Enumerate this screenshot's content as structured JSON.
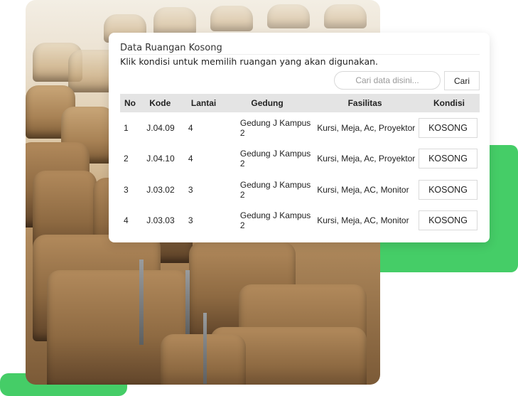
{
  "card": {
    "title": "Data Ruangan Kosong",
    "subtitle": "Klik kondisi untuk memilih ruangan yang akan digunakan."
  },
  "search": {
    "placeholder": "Cari data disini...",
    "button_label": "Cari"
  },
  "table": {
    "headers": {
      "no": "No",
      "kode": "Kode",
      "lantai": "Lantai",
      "gedung": "Gedung",
      "fasilitas": "Fasilitas",
      "kondisi": "Kondisi"
    },
    "rows": [
      {
        "no": "1",
        "kode": "J.04.09",
        "lantai": "4",
        "gedung": "Gedung J Kampus 2",
        "fasilitas": "Kursi, Meja, Ac, Proyektor",
        "kondisi": "KOSONG"
      },
      {
        "no": "2",
        "kode": "J.04.10",
        "lantai": "4",
        "gedung": "Gedung J Kampus 2",
        "fasilitas": "Kursi, Meja, Ac, Proyektor",
        "kondisi": "KOSONG"
      },
      {
        "no": "3",
        "kode": "J.03.02",
        "lantai": "3",
        "gedung": "Gedung J Kampus 2",
        "fasilitas": "Kursi, Meja, AC, Monitor",
        "kondisi": "KOSONG"
      },
      {
        "no": "4",
        "kode": "J.03.03",
        "lantai": "3",
        "gedung": "Gedung J Kampus 2",
        "fasilitas": "Kursi, Meja, AC, Monitor",
        "kondisi": "KOSONG"
      }
    ]
  },
  "colors": {
    "accent_green": "#45cd67",
    "header_bg": "#e4e4e4"
  }
}
